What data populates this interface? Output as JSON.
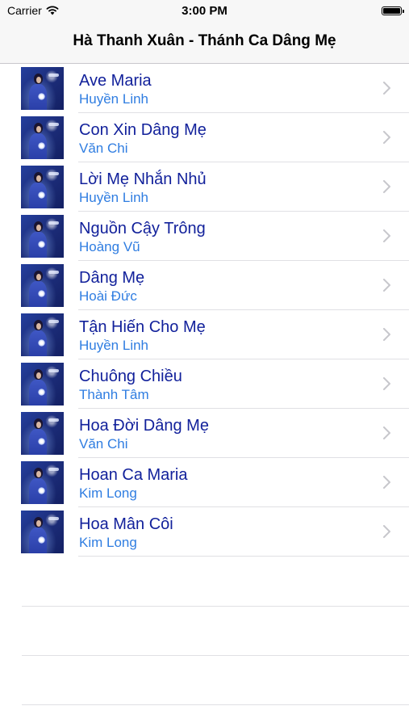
{
  "status_bar": {
    "carrier": "Carrier",
    "time": "3:00 PM"
  },
  "nav": {
    "title": "Hà Thanh Xuân - Thánh Ca Dâng Mẹ"
  },
  "colors": {
    "title_text": "#12219b",
    "subtitle_text": "#2f7de1",
    "chevron": "#c7c7cc"
  },
  "songs": [
    {
      "title": "Ave Maria",
      "artist": "Huyền Linh"
    },
    {
      "title": "Con Xin Dâng Mẹ",
      "artist": "Văn Chi"
    },
    {
      "title": "Lời Mẹ Nhắn Nhủ",
      "artist": "Huyền Linh"
    },
    {
      "title": "Nguồn Cậy Trông",
      "artist": "Hoàng Vũ"
    },
    {
      "title": "Dâng Mẹ",
      "artist": "Hoài Đức"
    },
    {
      "title": "Tận Hiến Cho Mẹ",
      "artist": "Huyền Linh"
    },
    {
      "title": "Chuông Chiều",
      "artist": "Thành Tâm"
    },
    {
      "title": "Hoa Đời Dâng Mẹ",
      "artist": "Văn Chi"
    },
    {
      "title": "Hoan Ca Maria",
      "artist": "Kim Long"
    },
    {
      "title": "Hoa Mân Côi",
      "artist": "Kim Long"
    }
  ]
}
